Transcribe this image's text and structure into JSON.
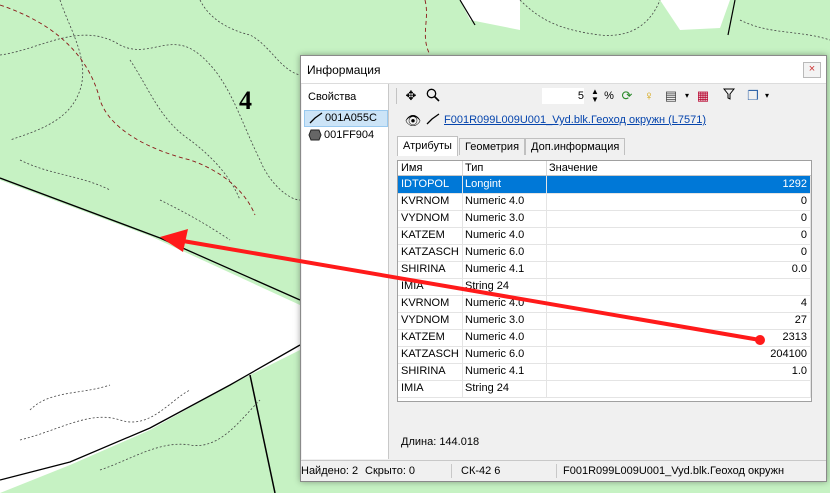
{
  "map": {
    "label": "4"
  },
  "window": {
    "title": "Информация",
    "close": "×"
  },
  "left_panel": {
    "header": "Свойства",
    "objects": [
      {
        "label": "001A055C",
        "icon": "polyline-icon"
      },
      {
        "label": "001FF904",
        "icon": "polygon-icon"
      }
    ]
  },
  "toolbar": {
    "zoom_value": "5",
    "percent": "%"
  },
  "object_line": {
    "name": "F001R099L009U001_Vyd.blk.Геоход окружн  (L7571)"
  },
  "tabs": [
    "Атрибуты",
    "Геометрия",
    "Доп.информация"
  ],
  "table": {
    "headers": [
      "Имя",
      "Тип",
      "Значение"
    ],
    "rows": [
      {
        "name": "IDTOPOL",
        "type": "Longint",
        "value": "1292"
      },
      {
        "name": "KVRNOM",
        "type": "Numeric 4.0",
        "value": "0"
      },
      {
        "name": "VYDNOM",
        "type": "Numeric 3.0",
        "value": "0"
      },
      {
        "name": "KATZEM",
        "type": "Numeric 4.0",
        "value": "0"
      },
      {
        "name": "KATZASCH",
        "type": "Numeric 6.0",
        "value": "0"
      },
      {
        "name": "SHIRINA",
        "type": "Numeric 4.1",
        "value": "0.0"
      },
      {
        "name": "IMIA",
        "type": "String 24",
        "value": ""
      },
      {
        "name": "KVRNOM",
        "type": "Numeric 4.0",
        "value": "4"
      },
      {
        "name": "VYDNOM",
        "type": "Numeric 3.0",
        "value": "27"
      },
      {
        "name": "KATZEM",
        "type": "Numeric 4.0",
        "value": "2313"
      },
      {
        "name": "KATZASCH",
        "type": "Numeric 6.0",
        "value": "204100"
      },
      {
        "name": "SHIRINA",
        "type": "Numeric 4.1",
        "value": "1.0"
      },
      {
        "name": "IMIA",
        "type": "String 24",
        "value": ""
      }
    ]
  },
  "length_text": "Длина: 144.018",
  "status": {
    "found": "Найдено: 2",
    "hidden": "Скрыто: 0",
    "crs": "СК-42 6",
    "object": "F001R099L009U001_Vyd.blk.Геоход окружн"
  },
  "colors": {
    "map_fill": "#c6f2c3",
    "selection": "#0078d7",
    "arrow": "#ff1a1a",
    "link": "#0645ad"
  }
}
